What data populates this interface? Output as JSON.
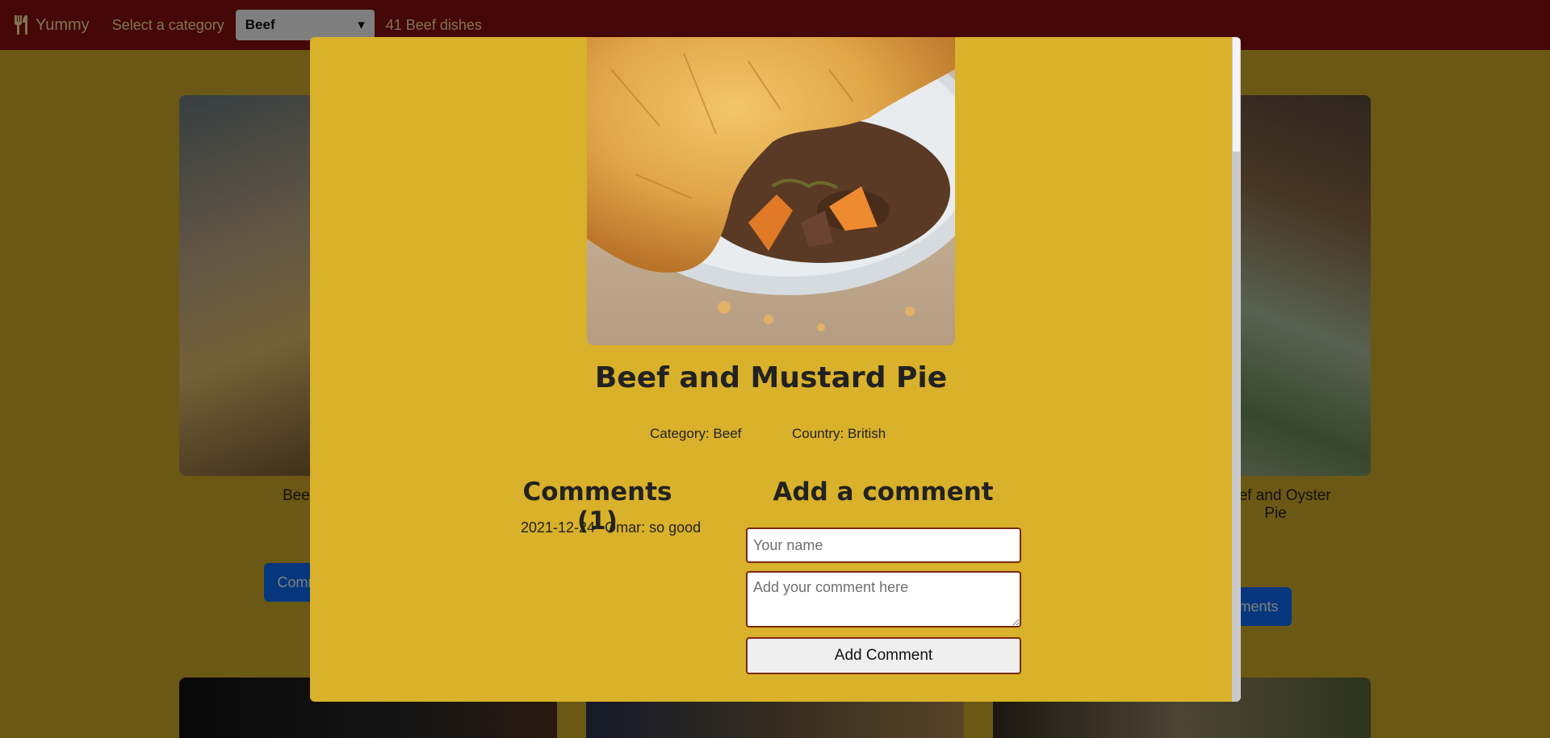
{
  "navbar": {
    "brand": "Yummy",
    "category_label": "Select a category",
    "category_value": "Beef",
    "count_text": "41 Beef dishes"
  },
  "background_cards": [
    {
      "title": "Beef and Mustard Pie",
      "button": "Comments"
    },
    {
      "title": "Beef and Oyster Pie",
      "button": "Comments"
    }
  ],
  "modal": {
    "meal_title": "Beef and Mustard Pie",
    "category": "Category: Beef",
    "country": "Country: British",
    "comments_heading": "Comments (1)",
    "comments": [
      {
        "date": "2021-12-24",
        "text": "Omar: so good"
      }
    ],
    "add_heading": "Add a comment",
    "name_placeholder": "Your name",
    "comment_placeholder": "Add your comment here",
    "submit_label": "Add Comment"
  },
  "colors": {
    "navbar": "#8b0f0f",
    "page_bg": "#d9b12a",
    "field_border": "#7a2a0a",
    "button_blue": "#0d6efd"
  },
  "icons": {
    "brand": "utensils-icon",
    "select": "chevron-down-icon"
  }
}
